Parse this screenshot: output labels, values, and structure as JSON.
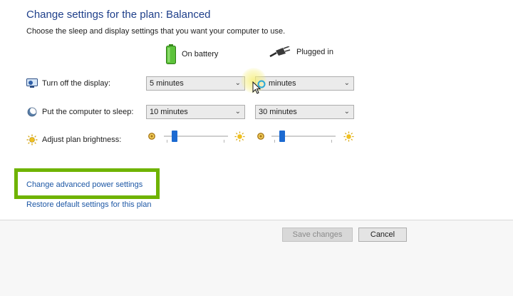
{
  "header": {
    "title": "Change settings for the plan: Balanced",
    "subtitle": "Choose the sleep and display settings that you want your computer to use."
  },
  "columns": {
    "battery": "On battery",
    "plugged": "Plugged in"
  },
  "rows": {
    "display": {
      "label": "Turn off the display:",
      "battery_value": "5 minutes",
      "plugged_value": "minutes"
    },
    "sleep": {
      "label": "Put the computer to sleep:",
      "battery_value": "10 minutes",
      "plugged_value": "30 minutes"
    },
    "brightness": {
      "label": "Adjust plan brightness:",
      "battery_level": 0.09,
      "plugged_level": 0.09
    }
  },
  "links": {
    "advanced": "Change advanced power settings",
    "restore": "Restore default settings for this plan"
  },
  "buttons": {
    "save": "Save changes",
    "cancel": "Cancel"
  },
  "colors": {
    "title": "#1e3f8a",
    "link": "#1d57a5",
    "highlight": "#6fb300",
    "slider_thumb": "#1c6ad1"
  },
  "icons": [
    "battery-icon",
    "plug-icon",
    "display-icon",
    "sleep-icon",
    "brightness-icon",
    "dim-sun-icon",
    "bright-sun-icon",
    "mouse-cursor-icon"
  ]
}
